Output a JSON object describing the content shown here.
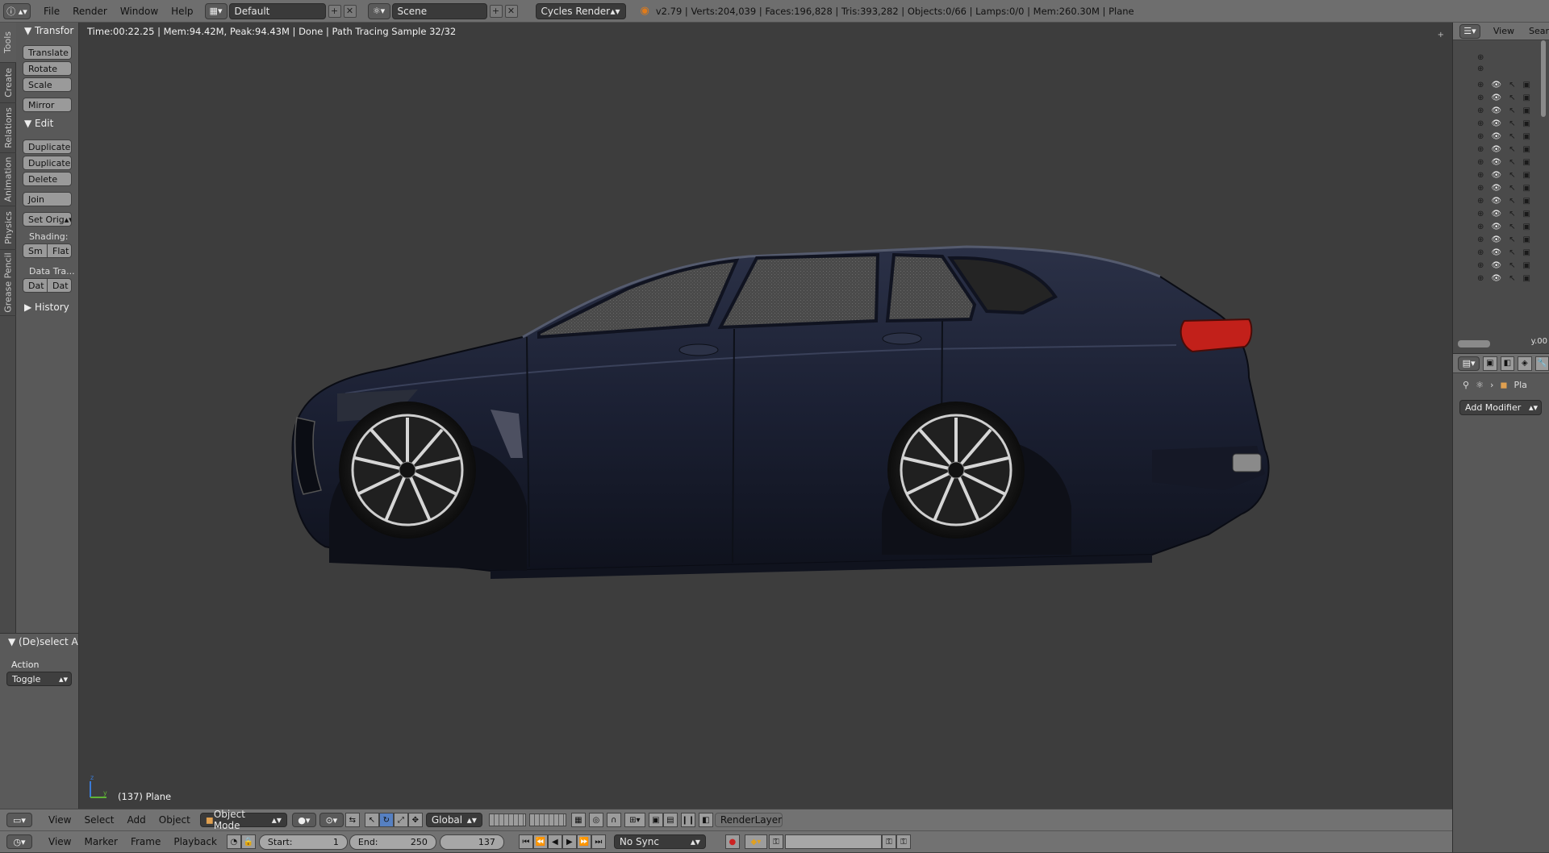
{
  "topbar": {
    "menus": [
      "File",
      "Render",
      "Window",
      "Help"
    ],
    "layout": "Default",
    "scene": "Scene",
    "engine": "Cycles Render",
    "stats": "v2.79 | Verts:204,039 | Faces:196,828 | Tris:393,282 | Objects:0/66 | Lamps:0/0 | Mem:260.30M | Plane"
  },
  "tabs": [
    "Tools",
    "Create",
    "Relations",
    "Animation",
    "Physics",
    "Grease Pencil"
  ],
  "shelf": {
    "transform_header": "Transfor",
    "transform_buttons": [
      "Translate",
      "Rotate",
      "Scale"
    ],
    "mirror": "Mirror",
    "edit_header": "Edit",
    "edit_buttons": [
      "Duplicate",
      "Duplicate",
      "Delete"
    ],
    "join": "Join",
    "set_origin": "Set Orig",
    "shading_label": "Shading:",
    "shading_smooth": "Sm",
    "shading_flat": "Flat",
    "data_transfer_label": "Data Tra...",
    "data_a": "Dat",
    "data_b": "Dat",
    "history": "History"
  },
  "operator": {
    "header": "(De)select All",
    "action_label": "Action",
    "action_value": "Toggle"
  },
  "viewport": {
    "info": "Time:00:22.25 | Mem:94.42M, Peak:94.43M | Done | Path Tracing Sample 32/32",
    "object_label": "(137) Plane",
    "axis_z": "z",
    "axis_y": "y"
  },
  "outliner": {
    "menu_view": "View",
    "menu_search": "Sear",
    "scroll_text": "y.00"
  },
  "properties": {
    "object_name": "Pla",
    "add_modifier": "Add Modifier"
  },
  "header3d": {
    "menus": [
      "View",
      "Select",
      "Add",
      "Object"
    ],
    "mode": "Object Mode",
    "orientation": "Global",
    "render_layer": "RenderLayer"
  },
  "timeline": {
    "menus": [
      "View",
      "Marker",
      "Frame",
      "Playback"
    ],
    "start_label": "Start:",
    "start_value": "1",
    "end_label": "End:",
    "end_value": "250",
    "current_frame": "137",
    "sync": "No Sync"
  },
  "colors": {
    "car_body": "#1b2033",
    "taillight": "#c2201a",
    "viewport_bg": "#3d3d3d"
  }
}
